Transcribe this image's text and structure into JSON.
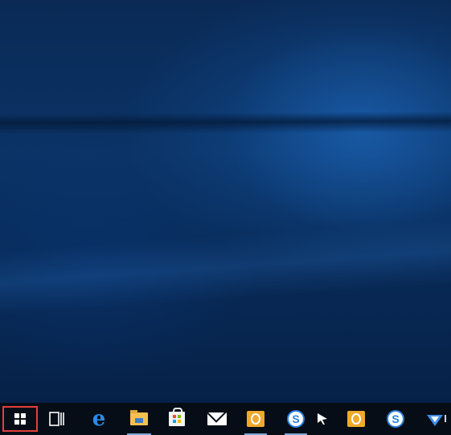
{
  "desktop": {
    "colors": {
      "background": "#0b3366",
      "taskbar": "#060d16",
      "start_highlight": "#e2403c"
    }
  },
  "taskbar": {
    "items": [
      {
        "name": "start",
        "icon": "windows-logo-icon"
      },
      {
        "name": "task-view",
        "icon": "task-view-icon"
      },
      {
        "name": "edge",
        "icon": "edge-icon",
        "glyph": "e"
      },
      {
        "name": "file-explorer",
        "icon": "folder-icon"
      },
      {
        "name": "store",
        "icon": "store-icon"
      },
      {
        "name": "mail",
        "icon": "mail-icon"
      },
      {
        "name": "outlook",
        "icon": "outlook-icon"
      },
      {
        "name": "sogou",
        "icon": "sogou-icon",
        "glyph": "S"
      },
      {
        "name": "pinned-app",
        "icon": "arrow-app-icon"
      },
      {
        "name": "outlook-2",
        "icon": "outlook-icon"
      },
      {
        "name": "sogou-2",
        "icon": "sogou-icon",
        "glyph": "S"
      },
      {
        "name": "tray",
        "icon": "tray-app-icon"
      }
    ]
  }
}
